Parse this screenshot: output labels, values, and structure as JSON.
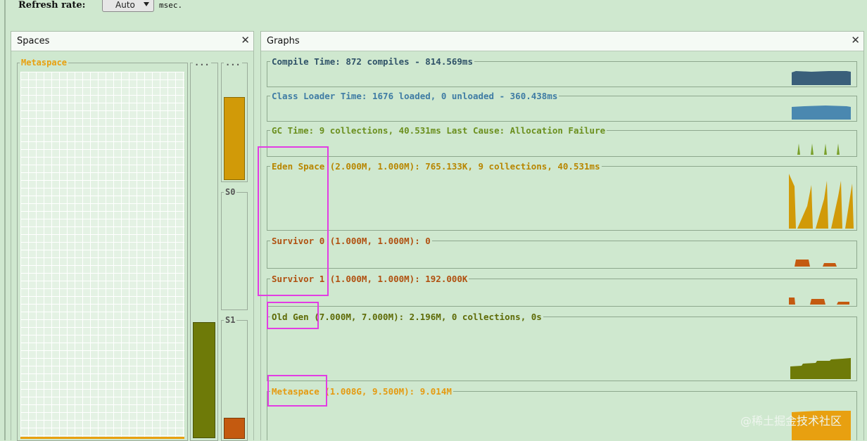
{
  "toolbar": {
    "refresh_label": "Refresh rate:",
    "refresh_value": "Auto",
    "refresh_unit": "msec."
  },
  "spaces_panel": {
    "title": "Spaces",
    "close": "✕",
    "metaspace_label": "Metaspace",
    "col2_label": "...",
    "col3_label": "...",
    "s0_label": "S0",
    "s1_label": "S1"
  },
  "graphs_panel": {
    "title": "Graphs",
    "close": "✕",
    "graphs": [
      {
        "title": "Compile Time: 872 compiles - 814.569ms",
        "color": "#3a5f7a"
      },
      {
        "title": "Class Loader Time: 1676 loaded, 0 unloaded - 360.438ms",
        "color": "#4a88b0"
      },
      {
        "title": "GC Time: 9 collections, 40.531ms Last Cause: Allocation Failure",
        "color": "#7aa02a"
      },
      {
        "title": "Eden Space (2.000M, 1.000M): 765.133K, 9 collections, 40.531ms",
        "color": "#d19a08"
      },
      {
        "title": "Survivor 0 (1.000M, 1.000M): 0",
        "color": "#c45a10"
      },
      {
        "title": "Survivor 1 (1.000M, 1.000M): 192.000K",
        "color": "#c45a10"
      },
      {
        "title": "Old Gen (7.000M, 7.000M): 2.196M, 0 collections, 0s",
        "color": "#6e7a08"
      },
      {
        "title": "Metaspace (1.008G, 9.500M): 9.014M",
        "color": "#e8a010"
      }
    ]
  },
  "watermark": "@稀土掘金技术社区"
}
